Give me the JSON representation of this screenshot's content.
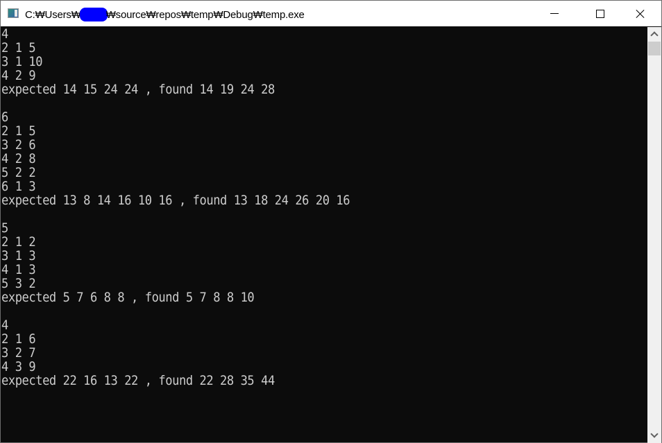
{
  "window": {
    "title_prefix": "C:₩Users₩",
    "title_suffix": "₩source₩repos₩temp₩Debug₩temp.exe",
    "title_redacted": true,
    "buttons": {
      "minimize": "minimize",
      "maximize": "maximize",
      "close": "close"
    }
  },
  "console": {
    "lines": [
      "4",
      "2 1 5",
      "3 1 10",
      "4 2 9",
      "expected 14 15 24 24 , found 14 19 24 28",
      "",
      "6",
      "2 1 5",
      "3 2 6",
      "4 2 8",
      "5 2 2",
      "6 1 3",
      "expected 13 8 14 16 10 16 , found 13 18 24 26 20 16",
      "",
      "5",
      "2 1 2",
      "3 1 3",
      "4 1 3",
      "5 3 2",
      "expected 5 7 6 8 8 , found 5 7 8 8 10",
      "",
      "4",
      "2 1 6",
      "3 2 7",
      "4 3 9",
      "expected 22 16 13 22 , found 22 28 35 44"
    ]
  },
  "colors": {
    "console_bg": "#0c0c0c",
    "console_fg": "#cccccc",
    "titlebar_bg": "#ffffff",
    "redaction": "#0000ff"
  }
}
